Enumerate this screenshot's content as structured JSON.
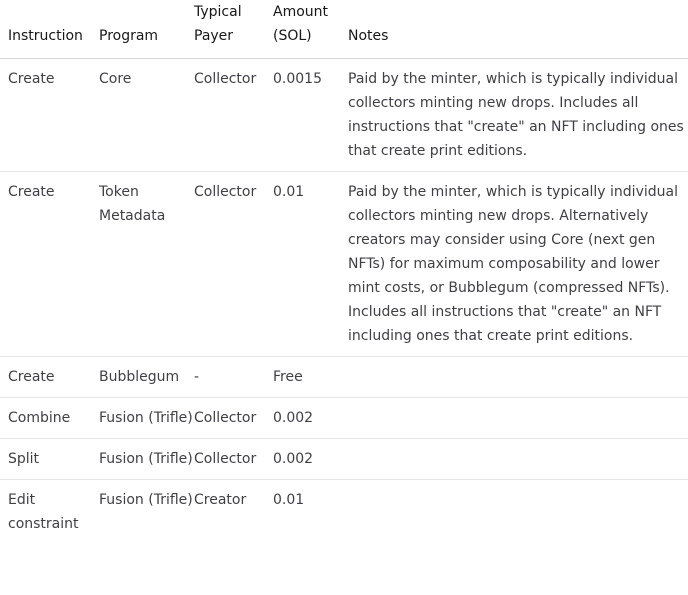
{
  "table": {
    "headers": {
      "instruction": "Instruction",
      "program": "Program",
      "payer_line1": "Typical",
      "payer_line2": "Payer",
      "amount_line1": "Amount",
      "amount_line2": "(SOL)",
      "notes": "Notes"
    },
    "rows": [
      {
        "instruction": "Create",
        "program": "Core",
        "payer": "Collector",
        "amount": "0.0015",
        "notes": "Paid by the minter, which is typically individual collectors minting new drops. Includes all instructions that \"create\" an NFT including ones that create print editions."
      },
      {
        "instruction": "Create",
        "program": "Token Metadata",
        "payer": "Collector",
        "amount": "0.01",
        "notes": "Paid by the minter, which is typically individual collectors minting new drops. Alternatively creators may consider using Core (next gen NFTs) for maximum composability and lower mint costs, or Bubblegum (compressed NFTs). Includes all instructions that \"create\" an NFT including ones that create print editions."
      },
      {
        "instruction": "Create",
        "program": "Bubblegum",
        "payer": "-",
        "amount": "Free",
        "notes": ""
      },
      {
        "instruction": "Combine",
        "program": "Fusion (Trifle)",
        "payer": "Collector",
        "amount": "0.002",
        "notes": ""
      },
      {
        "instruction": "Split",
        "program": "Fusion (Trifle)",
        "payer": "Collector",
        "amount": "0.002",
        "notes": ""
      },
      {
        "instruction": "Edit constraint",
        "program": "Fusion (Trifle)",
        "payer": "Creator",
        "amount": "0.01",
        "notes": ""
      }
    ]
  }
}
